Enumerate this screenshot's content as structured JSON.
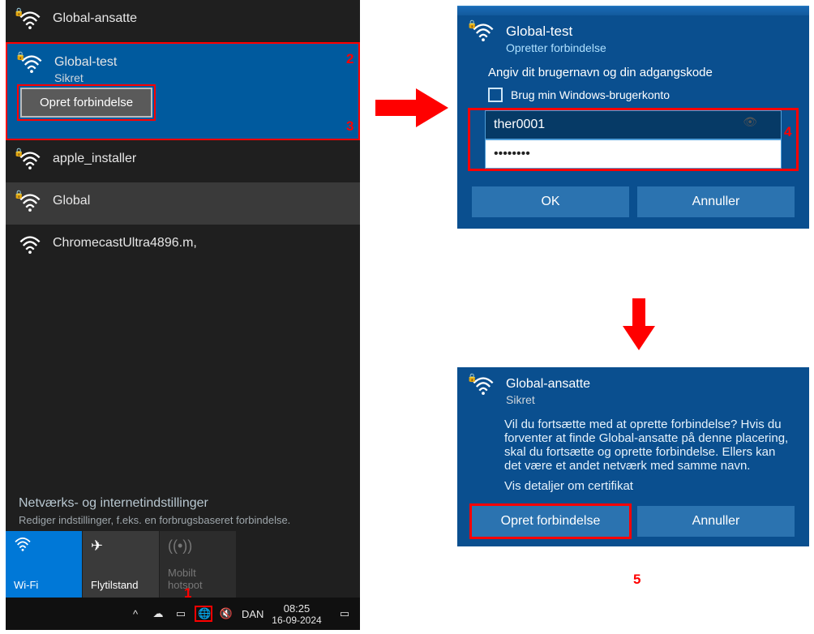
{
  "wifi_panel": {
    "networks": [
      {
        "name": "Global-ansatte",
        "secured": true,
        "subtitle": ""
      },
      {
        "name": "Global-test",
        "secured": true,
        "subtitle": "Sikret"
      },
      {
        "name": "apple_installer",
        "secured": true,
        "subtitle": ""
      },
      {
        "name": "Global",
        "secured": true,
        "subtitle": ""
      },
      {
        "name": "ChromecastUltra4896.m,",
        "secured": false,
        "subtitle": ""
      }
    ],
    "connect_label": "Opret forbindelse",
    "settings_title": "Netværks- og internetindstillinger",
    "settings_subtitle": "Rediger indstillinger, f.eks. en forbrugsbaseret forbindelse.",
    "tiles": {
      "wifi": "Wi-Fi",
      "airplane": "Flytilstand",
      "hotspot": "Mobilt hotspot"
    },
    "taskbar": {
      "lang": "DAN",
      "time": "08:25",
      "date": "16-09-2024"
    }
  },
  "credentials": {
    "network": "Global-test",
    "status": "Opretter forbindelse",
    "instruction": "Angiv dit brugernavn og din adgangskode",
    "checkbox_label": "Brug min Windows-brugerkonto",
    "username_value": "ther0001",
    "password_value": "••••••••",
    "ok_label": "OK",
    "cancel_label": "Annuller"
  },
  "confirm": {
    "network": "Global-ansatte",
    "subtitle": "Sikret",
    "message": "Vil du fortsætte med at oprette forbindelse? Hvis du forventer at finde Global-ansatte på denne placering, skal du fortsætte og oprette forbindelse. Ellers kan det være et andet netværk med samme navn.",
    "link": "Vis detaljer om certifikat",
    "connect_label": "Opret forbindelse",
    "cancel_label": "Annuller"
  },
  "annotations": {
    "a1": "1",
    "a2": "2",
    "a3": "3",
    "a4": "4",
    "a5": "5"
  }
}
